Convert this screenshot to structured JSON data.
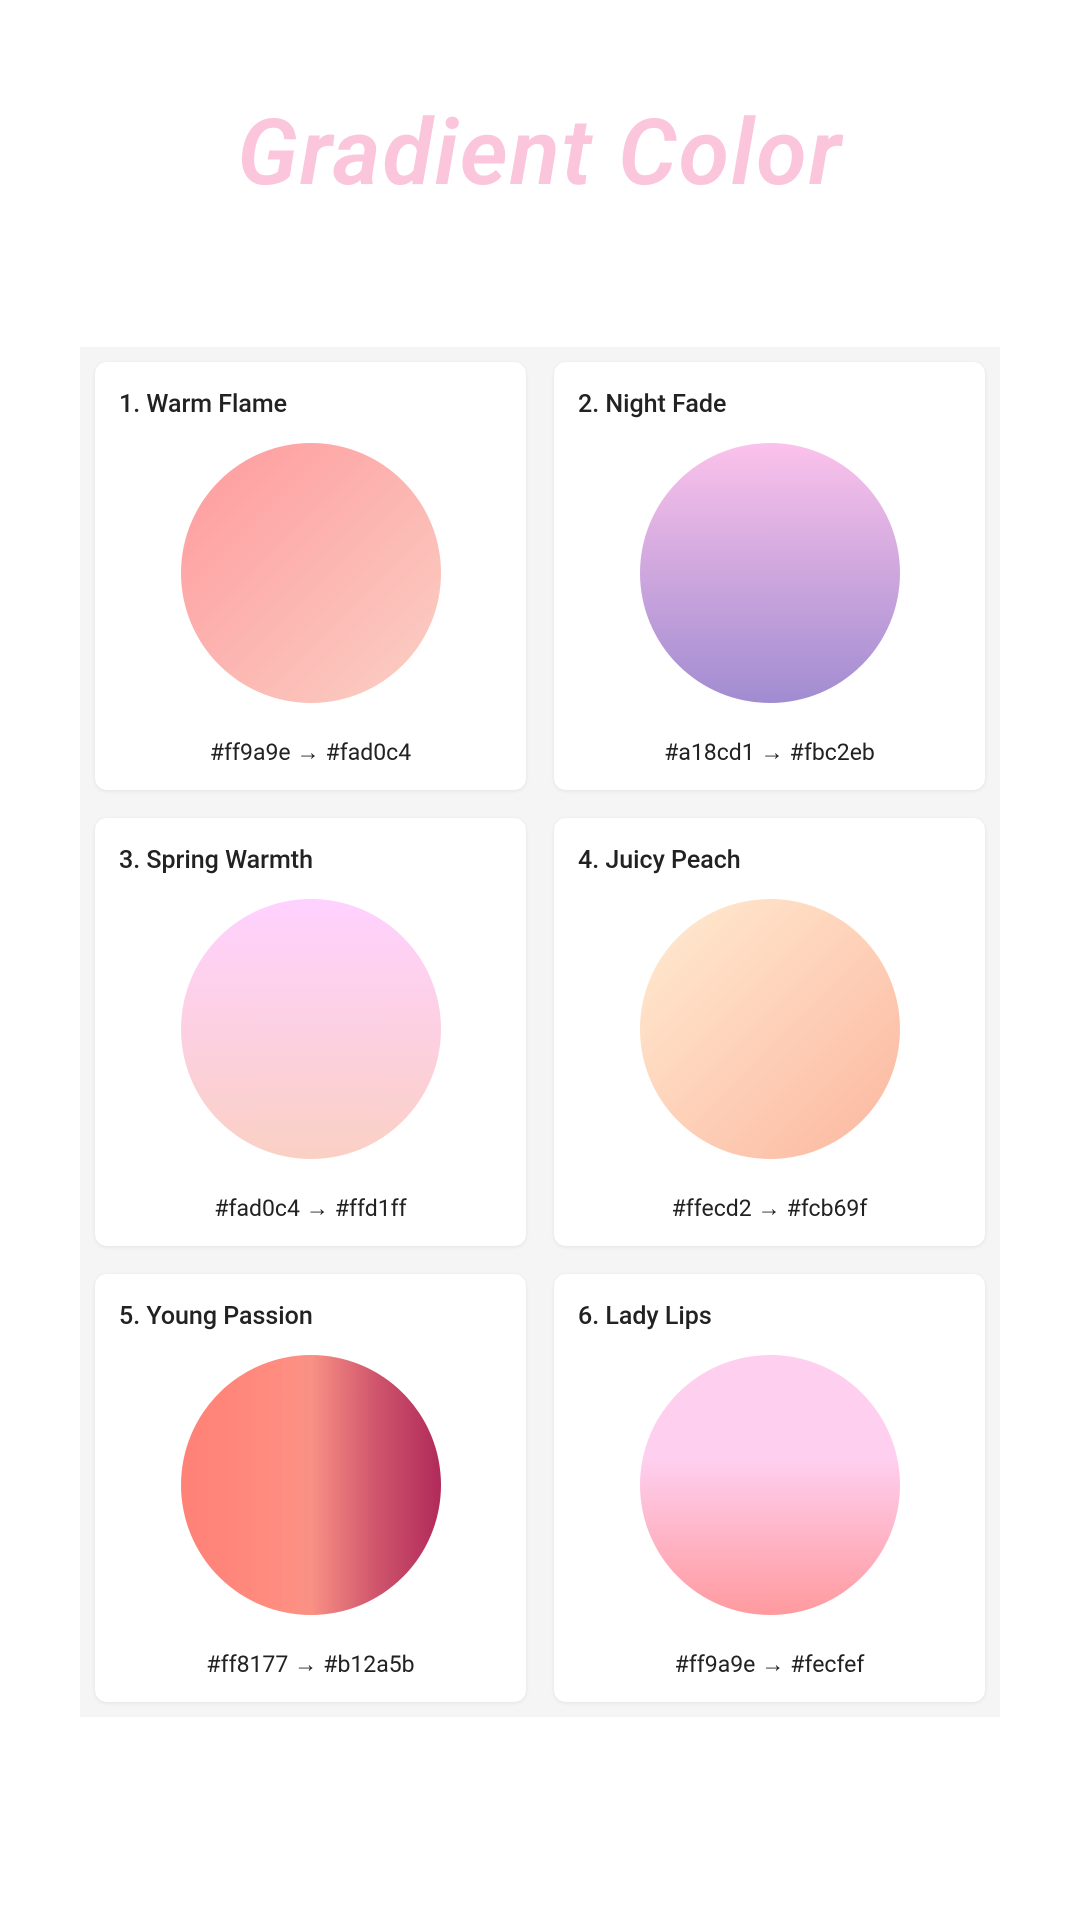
{
  "title": "Gradient Color",
  "arrow": "→",
  "cards": [
    {
      "index": "1",
      "name": "Warm Flame",
      "from": "#ff9a9e",
      "to": "#fad0c4",
      "gradient": "linear-gradient(135deg, #ff9a9e 0%, #fad0c4 100%)"
    },
    {
      "index": "2",
      "name": "Night Fade",
      "from": "#a18cd1",
      "to": "#fbc2eb",
      "gradient": "linear-gradient(0deg, #a18cd1 0%, #fbc2eb 100%)"
    },
    {
      "index": "3",
      "name": "Spring Warmth",
      "from": "#fad0c4",
      "to": "#ffd1ff",
      "gradient": "linear-gradient(0deg, #fad0c4 0%, #ffd1ff 100%)"
    },
    {
      "index": "4",
      "name": "Juicy Peach",
      "from": "#ffecd2",
      "to": "#fcb69f",
      "gradient": "linear-gradient(135deg, #ffecd2 0%, #fcb69f 100%)"
    },
    {
      "index": "5",
      "name": "Young Passion",
      "from": "#ff8177",
      "to": "#b12a5b",
      "gradient": "linear-gradient(90deg, #ff8177 0%, #ff867a 20%, #ff8c7f 35%, #f99185 50%, #cf556c 75%, #b12a5b 100%)"
    },
    {
      "index": "6",
      "name": "Lady Lips",
      "from": "#ff9a9e",
      "to": "#fecfef",
      "gradient": "linear-gradient(0deg, #ff9a9e 0%, #fecfef 60%, #fecfef 100%)"
    }
  ]
}
